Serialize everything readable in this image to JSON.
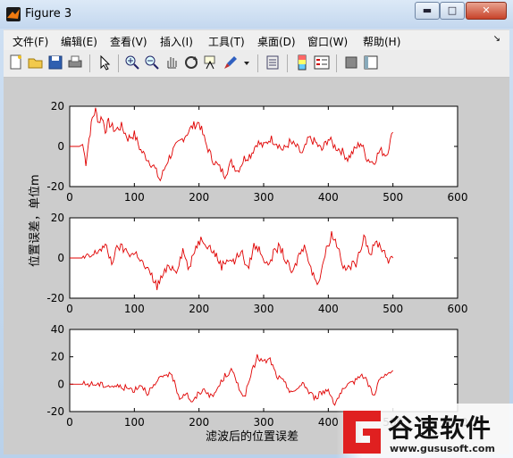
{
  "window": {
    "title": "Figure 3",
    "minimize_glyph": "▬",
    "maximize_glyph": "□",
    "close_glyph": "✕"
  },
  "menubar": {
    "items": [
      "文件(F)",
      "编辑(E)",
      "查看(V)",
      "插入(I)",
      "工具(T)",
      "桌面(D)",
      "窗口(W)",
      "帮助(H)"
    ],
    "overflow_glyph": "↘"
  },
  "toolbar": {
    "icons": [
      "new-figure-icon",
      "open-icon",
      "save-icon",
      "print-icon",
      "pointer-icon",
      "zoom-in-icon",
      "zoom-out-icon",
      "pan-icon",
      "rotate-icon",
      "data-cursor-icon",
      "brush-icon",
      "link-icon",
      "colorbar-icon",
      "legend-icon",
      "hide-plot-tools-icon",
      "show-plot-tools-icon"
    ]
  },
  "figure": {
    "ylabel": "位置误差，单位m",
    "xlabel": "滤波后的位置误差",
    "line_color": "#e00000"
  },
  "chart_data": [
    {
      "type": "line",
      "xlim": [
        0,
        600
      ],
      "ylim": [
        -20,
        20
      ],
      "xticks": [
        "0",
        "100",
        "200",
        "300",
        "400",
        "500",
        "600"
      ],
      "yticks": [
        "20",
        "0",
        "-20"
      ],
      "series": [
        {
          "x": [
            0,
            15,
            20,
            25,
            30,
            35,
            40,
            45,
            50,
            55,
            60,
            70,
            80,
            90,
            100,
            110,
            120,
            130,
            140,
            150,
            160,
            170,
            180,
            190,
            200,
            210,
            220,
            230,
            240,
            250,
            260,
            270,
            280,
            290,
            300,
            310,
            320,
            330,
            340,
            350,
            360,
            370,
            380,
            390,
            400,
            410,
            420,
            430,
            440,
            450,
            460,
            470,
            480,
            490,
            500
          ],
          "values": [
            0,
            0,
            1,
            -8,
            4,
            14,
            18,
            12,
            15,
            8,
            12,
            8,
            10,
            4,
            6,
            -2,
            -6,
            -10,
            -17,
            -8,
            -2,
            2,
            6,
            10,
            12,
            2,
            -6,
            -10,
            -14,
            -8,
            -12,
            -6,
            -4,
            2,
            0,
            4,
            2,
            -2,
            2,
            0,
            -4,
            4,
            2,
            -2,
            4,
            0,
            -2,
            -6,
            -2,
            2,
            -6,
            -8,
            -2,
            -4,
            7
          ]
        }
      ]
    },
    {
      "type": "line",
      "xlim": [
        0,
        600
      ],
      "ylim": [
        -20,
        20
      ],
      "xticks": [
        "0",
        "100",
        "200",
        "300",
        "400",
        "500",
        "600"
      ],
      "yticks": [
        "20",
        "0",
        "-20"
      ],
      "series": [
        {
          "x": [
            0,
            15,
            25,
            35,
            45,
            55,
            65,
            75,
            85,
            95,
            105,
            115,
            125,
            135,
            145,
            155,
            165,
            175,
            185,
            195,
            205,
            215,
            225,
            235,
            245,
            255,
            265,
            275,
            285,
            295,
            305,
            315,
            325,
            335,
            345,
            355,
            365,
            375,
            385,
            395,
            405,
            415,
            425,
            435,
            445,
            455,
            465,
            475,
            485,
            495,
            500
          ],
          "values": [
            0,
            0,
            0,
            1,
            4,
            6,
            -2,
            6,
            4,
            2,
            2,
            -4,
            -8,
            -14,
            -8,
            -4,
            -6,
            4,
            -6,
            6,
            10,
            6,
            2,
            -4,
            0,
            -2,
            4,
            -6,
            6,
            4,
            -4,
            2,
            6,
            -2,
            -8,
            2,
            6,
            -8,
            -12,
            2,
            12,
            6,
            -6,
            -4,
            -2,
            12,
            2,
            8,
            4,
            -2,
            0
          ]
        }
      ]
    },
    {
      "type": "line",
      "xlim": [
        0,
        600
      ],
      "ylim": [
        -20,
        40
      ],
      "xticks": [
        "0",
        "100",
        "200",
        "300",
        "400",
        "500",
        "600"
      ],
      "yticks": [
        "40",
        "20",
        "0",
        "-20"
      ],
      "series": [
        {
          "x": [
            0,
            20,
            40,
            60,
            80,
            100,
            110,
            120,
            130,
            140,
            150,
            160,
            170,
            180,
            190,
            200,
            210,
            220,
            230,
            240,
            250,
            260,
            270,
            280,
            290,
            300,
            310,
            320,
            330,
            340,
            350,
            360,
            370,
            380,
            390,
            400,
            410,
            420,
            430,
            440,
            450,
            460,
            470,
            480,
            490,
            500
          ],
          "values": [
            0,
            0,
            0,
            -1,
            -2,
            -4,
            0,
            -6,
            -2,
            4,
            8,
            4,
            -10,
            -6,
            -14,
            -6,
            -4,
            -10,
            -2,
            6,
            10,
            0,
            -10,
            6,
            20,
            16,
            18,
            6,
            2,
            -4,
            -6,
            2,
            -6,
            -10,
            -6,
            -4,
            -14,
            -6,
            -2,
            2,
            8,
            2,
            -8,
            4,
            6,
            10
          ]
        }
      ]
    }
  ],
  "watermark": {
    "text": "谷速软件",
    "url": "www.gususoft.com"
  }
}
